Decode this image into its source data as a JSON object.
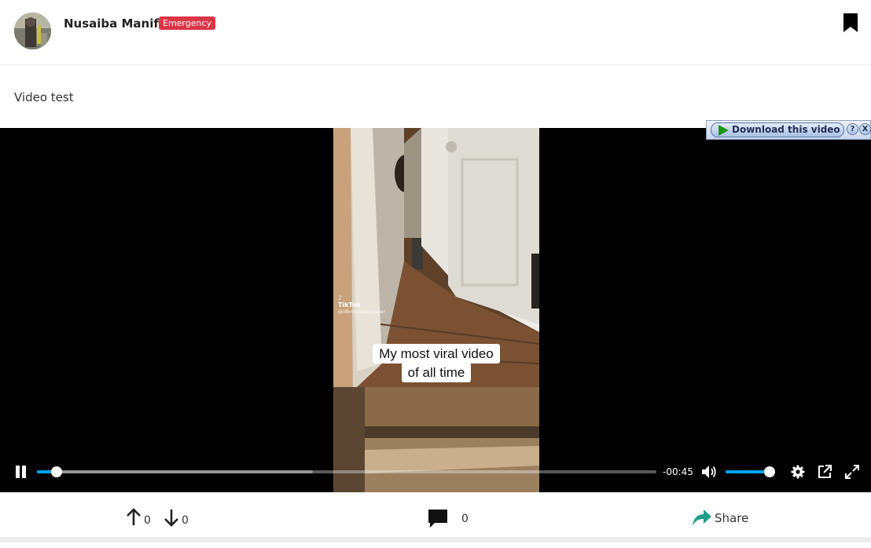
{
  "post": {
    "author": "Nusaiba Manifa",
    "badge": "Emergency",
    "text": "Video test"
  },
  "video": {
    "caption_line1": "My most viral video",
    "caption_line2": "of all time",
    "watermark_brand": "TikTok",
    "watermark_handle": "@idkmlolsuppppper",
    "time_remaining": "-00:45",
    "progress_played": 0.032,
    "progress_buffered": 0.445,
    "volume_level": 0.9,
    "download_label": "Download this video",
    "download_help": "?",
    "download_close": "X"
  },
  "footer": {
    "upvotes": "0",
    "downvotes": "0",
    "comments": "0",
    "share_label": "Share"
  },
  "colors": {
    "badge": "#dc3545",
    "accent": "#00a3ff",
    "share_icon": "#1e9e88"
  },
  "icons": {
    "bookmark": "bookmark-icon",
    "pause": "pause-icon",
    "volume": "volume-icon",
    "settings": "gear-icon",
    "popout": "external-link-icon",
    "fullscreen": "fullscreen-icon",
    "upvote": "arrow-up-icon",
    "downvote": "arrow-down-icon",
    "comment": "comment-icon",
    "share": "share-icon"
  }
}
